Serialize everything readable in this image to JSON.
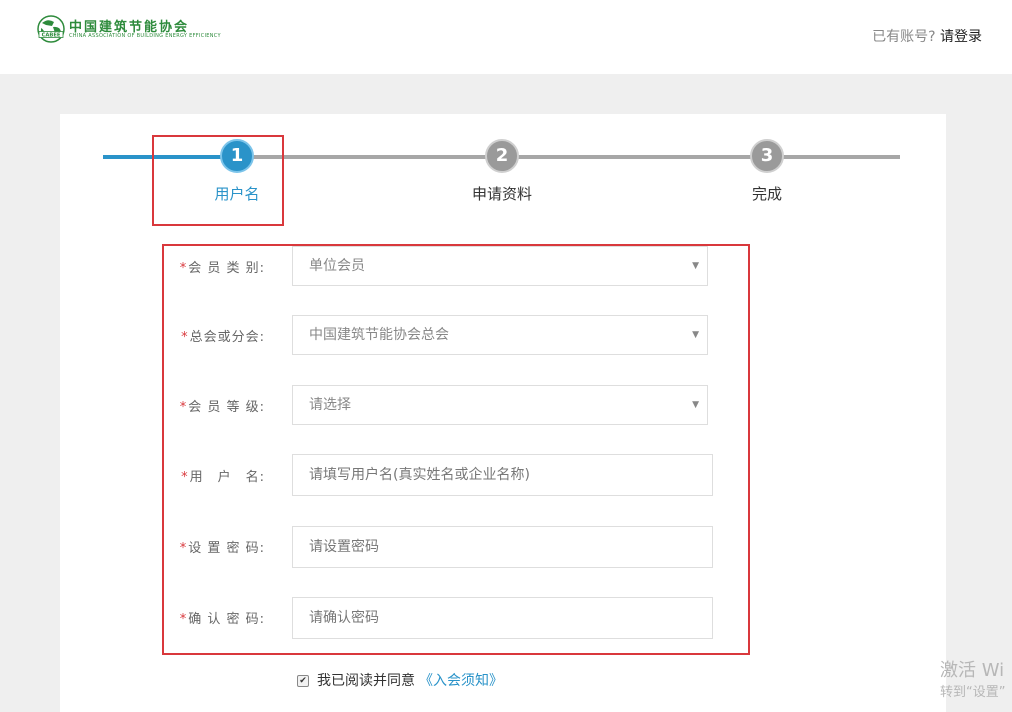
{
  "header": {
    "logo": {
      "badge_text": "CABEE",
      "name_cn": "中国建筑节能协会",
      "name_en": "CHINA ASSOCIATION OF BUILDING ENERGY EFFICIENCY"
    },
    "login_prompt": "已有账号?",
    "login_link": "请登录"
  },
  "steps": [
    {
      "number": "1",
      "label": "用户名",
      "state": "active"
    },
    {
      "number": "2",
      "label": "申请资料",
      "state": "pending"
    },
    {
      "number": "3",
      "label": "完成",
      "state": "pending"
    }
  ],
  "form": {
    "required_mark": "*",
    "member_type": {
      "label": "会 员 类 别:",
      "value": "单位会员"
    },
    "branch": {
      "label": "总会或分会:",
      "value": "中国建筑节能协会总会"
    },
    "member_level": {
      "label": "会 员 等 级:",
      "value": "请选择"
    },
    "username": {
      "label": "用　户　名:",
      "placeholder": "请填写用户名(真实姓名或企业名称)"
    },
    "password": {
      "label": "设 置 密 码:",
      "placeholder": "请设置密码"
    },
    "confirm_password": {
      "label": "确 认 密 码:",
      "placeholder": "请确认密码"
    },
    "dropdown_arrow": "▼"
  },
  "agreement": {
    "checked": true,
    "check_mark": "✔",
    "text": "我已阅读并同意",
    "link": "《入会须知》"
  },
  "watermark": {
    "line1": "激活 Wi",
    "line2": "转到“设置”"
  },
  "colors": {
    "accent": "#2a93c9",
    "annotation": "#d9383c",
    "logo_green": "#2e8b3c"
  }
}
